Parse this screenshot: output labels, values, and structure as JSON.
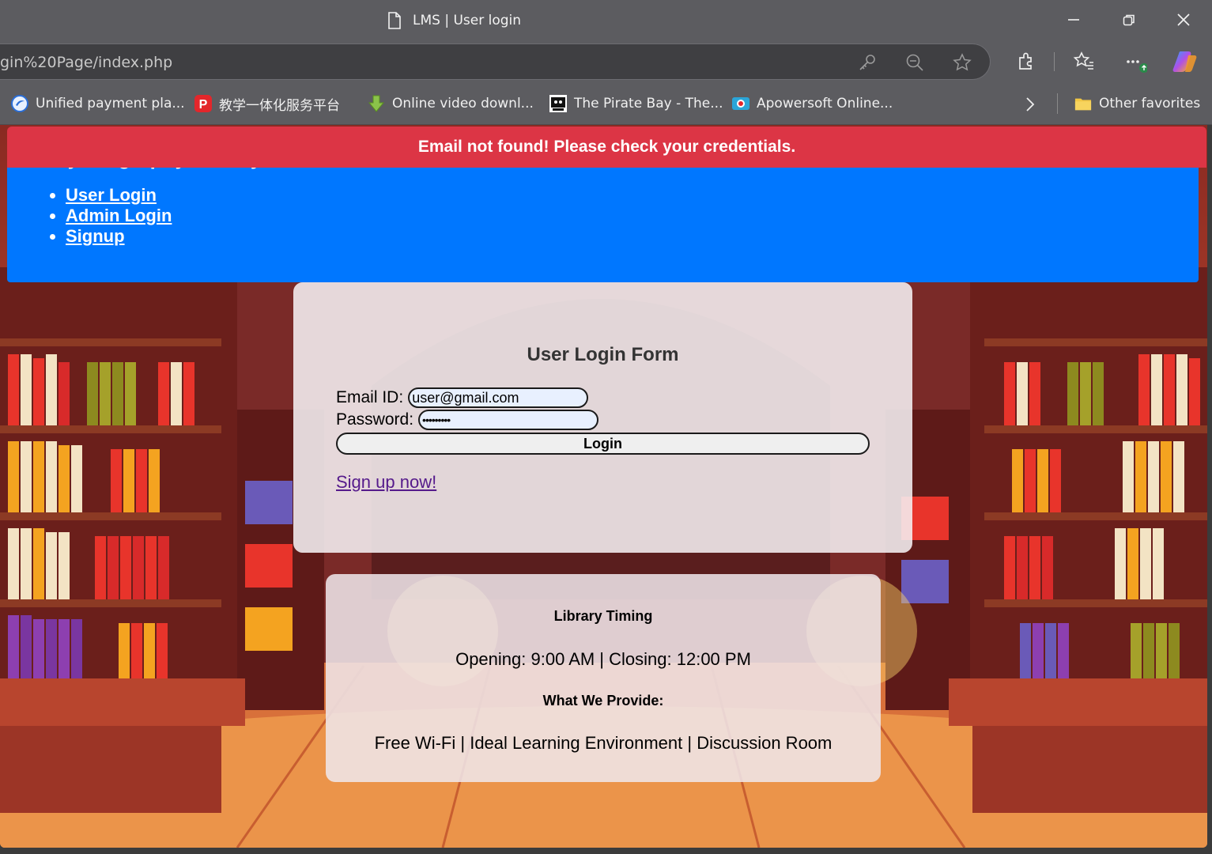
{
  "browser": {
    "tab_title": "LMS | User login",
    "url": "gin%20Page/index.php",
    "favorites": [
      {
        "label": "Unified payment pla...",
        "icon": "unified-payment-icon"
      },
      {
        "label": "教学一体化服务平台",
        "icon": "p-logo-icon"
      },
      {
        "label": "Online video downl...",
        "icon": "download-arrow-icon"
      },
      {
        "label": "The Pirate Bay - The...",
        "icon": "pirate-bay-icon"
      },
      {
        "label": "Apowersoft Online...",
        "icon": "apowersoft-icon"
      }
    ],
    "other_favorites": "Other favorites"
  },
  "alert": {
    "message": "Email not found! Please check your credentials.",
    "color": "#dc3545"
  },
  "header": {
    "title": "My Biography Library",
    "color": "#0077ff",
    "nav": [
      "User Login",
      "Admin Login",
      "Signup"
    ]
  },
  "login_form": {
    "title": "User Login Form",
    "email_label": "Email ID:",
    "email_value": "user@gmail.com",
    "password_label": "Password:",
    "password_value": "•••••••••",
    "submit_label": "Login",
    "signup_link": "Sign up now!"
  },
  "info": {
    "timing_heading": "Library Timing",
    "timing_text": "Opening: 9:00 AM | Closing: 12:00 PM",
    "provide_heading": "What We Provide:",
    "provide_text": "Free Wi-Fi | Ideal Learning Environment | Discussion Room"
  }
}
